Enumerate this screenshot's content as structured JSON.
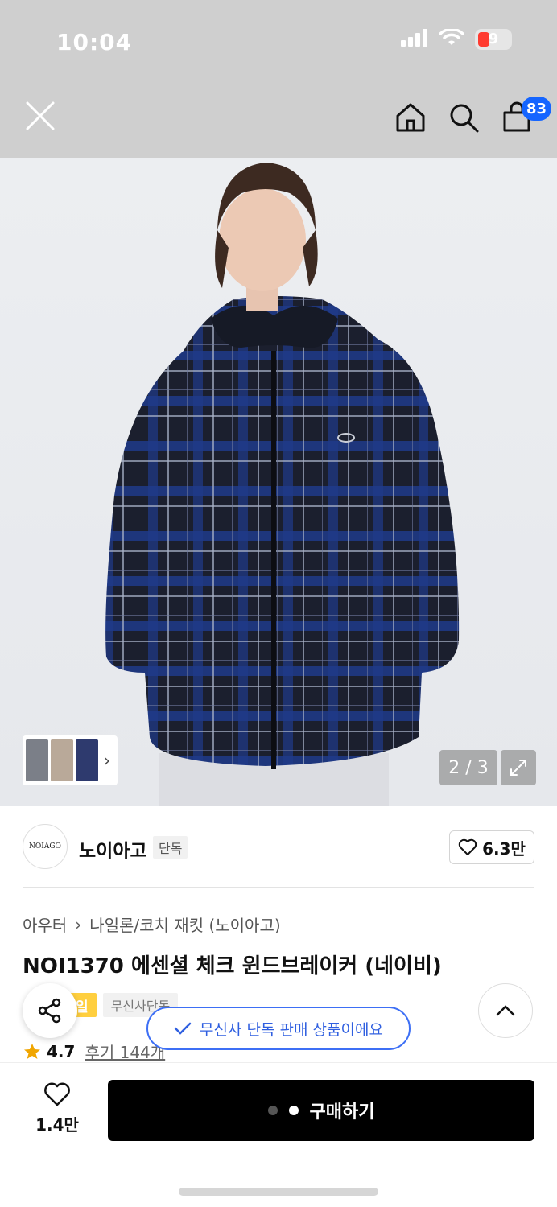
{
  "status": {
    "time": "10:04",
    "battery": "9",
    "battery_color": "#ff3b30"
  },
  "nav": {
    "cart_count": "83",
    "badge_color": "#1565ff"
  },
  "gallery": {
    "counter": "2 / 3",
    "current": 2,
    "total": 3
  },
  "brand": {
    "logo_text": "NOIAGO",
    "name": "노이아고",
    "exclusive_tag": "단독",
    "likes": "6.3만"
  },
  "breadcrumb": {
    "category": "아우터",
    "separator": "›",
    "subcategory": "나일론/코치 재킷 (노이아고)"
  },
  "product": {
    "title": "NOI1370 에센셜 체크 윈드브레이커 (네이비)"
  },
  "tags": {
    "sale": "일",
    "exclusive": "무신사단독"
  },
  "toast": {
    "text": "무신사 단독 판매 상품이에요"
  },
  "rating": {
    "score": "4.7",
    "reviews": "후기 144개",
    "star_color": "#f0a500"
  },
  "bottom": {
    "wish_count": "1.4만",
    "buy_label": "구매하기"
  },
  "colors": {
    "accent": "#1565ff",
    "toast_border": "#3d6ff5",
    "buy_bg": "#000000"
  }
}
